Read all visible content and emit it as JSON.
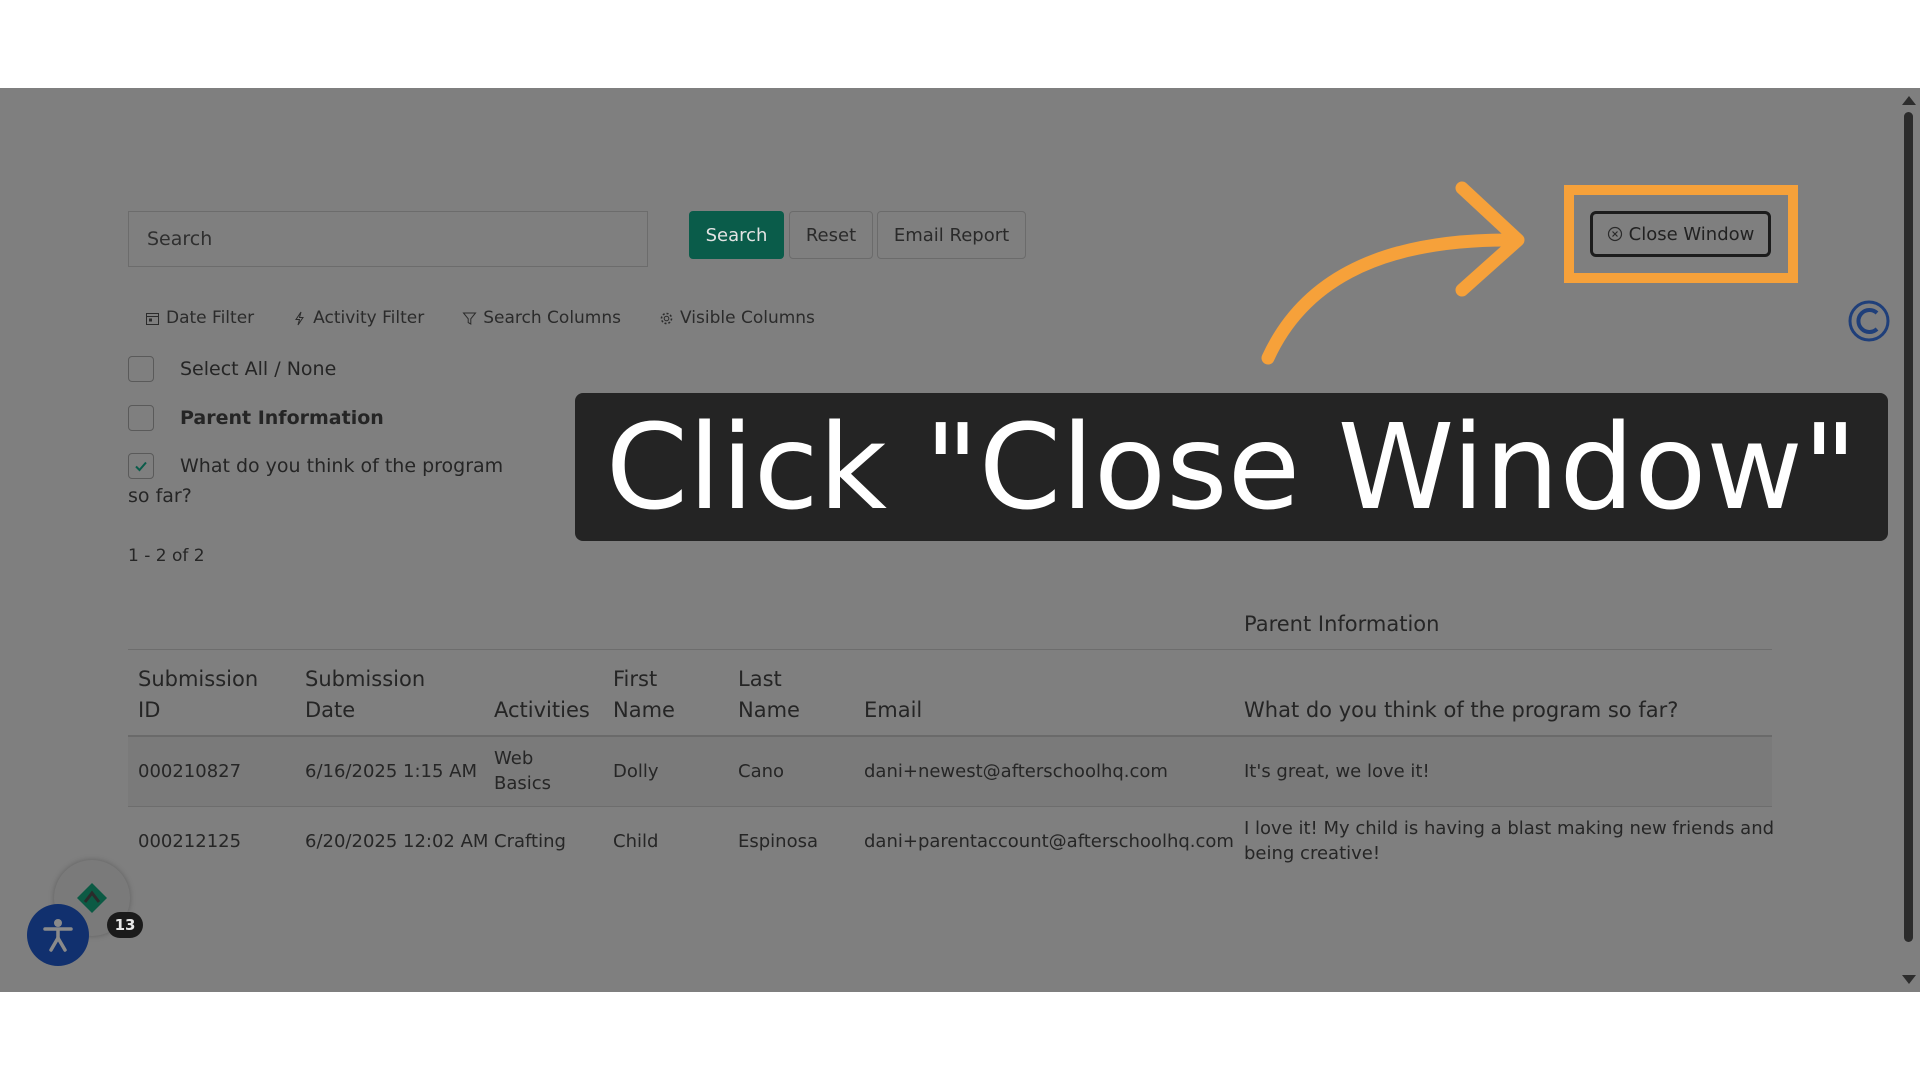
{
  "search": {
    "placeholder": "Search",
    "search_label": "Search",
    "reset_label": "Reset",
    "email_label": "Email Report",
    "close_label": "Close Window"
  },
  "filters": [
    {
      "label": "Date Filter",
      "icon": "calendar-icon"
    },
    {
      "label": "Activity Filter",
      "icon": "lightning-icon"
    },
    {
      "label": "Search Columns",
      "icon": "funnel-icon"
    },
    {
      "label": "Visible Columns",
      "icon": "gear-icon"
    }
  ],
  "columns_toggle": {
    "select_all": "Select All / None",
    "parent_info": "Parent Information",
    "question_line1": "What do you think of the program",
    "question_line2": "so far?",
    "question_checked": true
  },
  "result_count": "1 - 2 of 2",
  "table": {
    "group_header": "Parent Information",
    "headers": {
      "submission_id_1": "Submission",
      "submission_id_2": "ID",
      "submission_date_1": "Submission",
      "submission_date_2": "Date",
      "activities": "Activities",
      "first_name_1": "First",
      "first_name_2": "Name",
      "last_name_1": "Last",
      "last_name_2": "Name",
      "email": "Email",
      "question": "What do you think of the program so far?"
    },
    "rows": [
      {
        "id": "000210827",
        "date": "6/16/2025 1:15 AM",
        "activity_1": "Web",
        "activity_2": "Basics",
        "first": "Dolly",
        "last": "Cano",
        "email": "dani+newest@afterschoolhq.com",
        "answer_1": "It's great, we love it!",
        "answer_2": ""
      },
      {
        "id": "000212125",
        "date": "6/20/2025 12:02 AM",
        "activity_1": "Crafting",
        "activity_2": "",
        "first": "Child",
        "last": "Espinosa",
        "email": "dani+parentaccount@afterschoolhq.com",
        "answer_1": "I love it! My child is having a blast making new friends and",
        "answer_2": "being creative!"
      }
    ]
  },
  "caption": "Click \"Close Window\"",
  "notifications_count": "13",
  "colors": {
    "overlay": "#7f7f7f",
    "accent_green": "#0a5c4a",
    "highlight_orange": "#f6a13a",
    "caption_bg": "#242424",
    "a11y_blue": "#11306e"
  }
}
